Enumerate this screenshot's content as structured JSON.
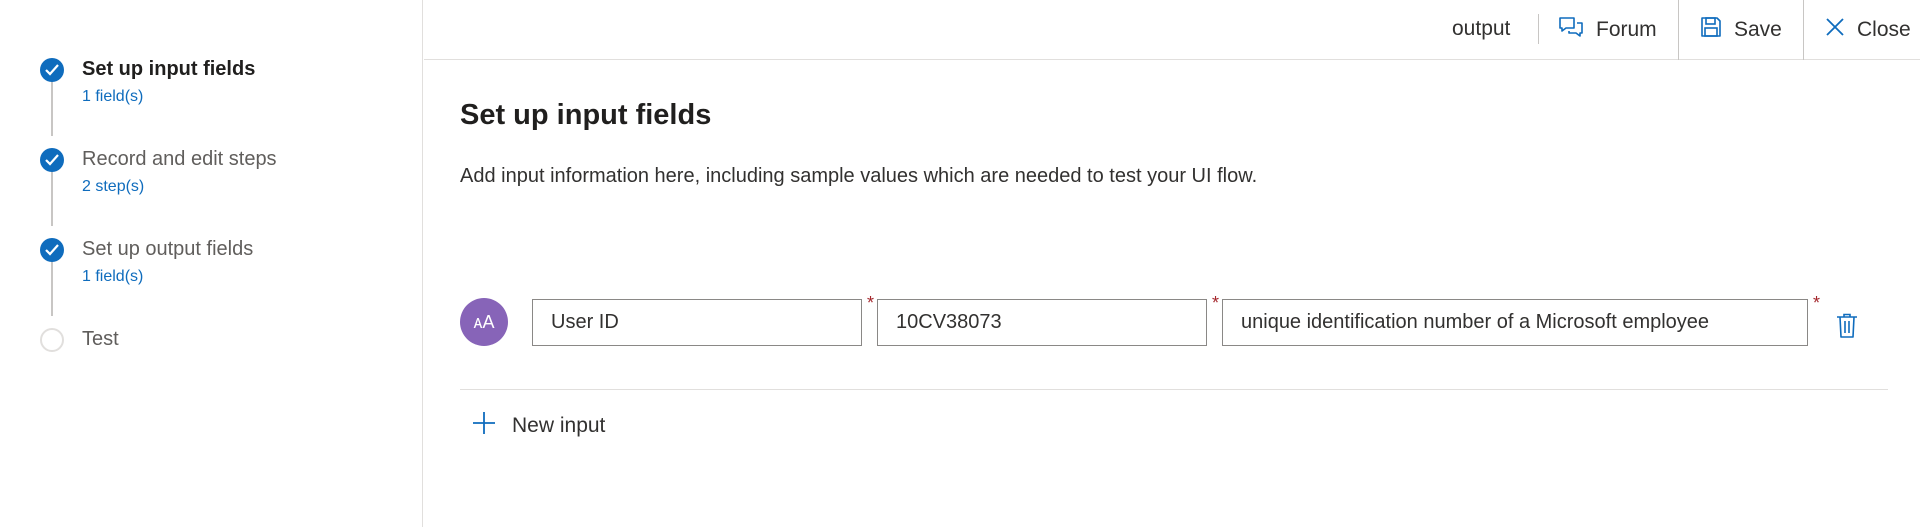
{
  "steps": [
    {
      "label": "Set up input fields",
      "sub": "1 field(s)",
      "status": "done",
      "active": true
    },
    {
      "label": "Record and edit steps",
      "sub": "2 step(s)",
      "status": "done",
      "active": false
    },
    {
      "label": "Set up output fields",
      "sub": "1 field(s)",
      "status": "done",
      "active": false
    },
    {
      "label": "Test",
      "sub": "",
      "status": "todo",
      "active": false
    }
  ],
  "toolbar": {
    "output_label": "output",
    "forum_label": "Forum",
    "save_label": "Save",
    "close_label": "Close"
  },
  "main": {
    "title": "Set up input fields",
    "description": "Add input information here, including sample values which are needed to test your UI flow.",
    "input_row": {
      "avatar_text": "ᴀA",
      "name": "User ID",
      "sample_value": "10CV38073",
      "description": "unique identification number of a Microsoft employee",
      "required_mark": "*"
    },
    "new_input_label": "New input"
  },
  "icons": {
    "step_done": "checkmark-icon",
    "forum": "chat-icon",
    "save": "floppy-disk-icon",
    "close": "close-icon",
    "delete": "trash-icon",
    "add": "plus-icon"
  },
  "colors": {
    "accent": "#0f6cbd",
    "avatar": "#8764b8",
    "required": "#a4262c",
    "border": "#e1dfdd"
  }
}
